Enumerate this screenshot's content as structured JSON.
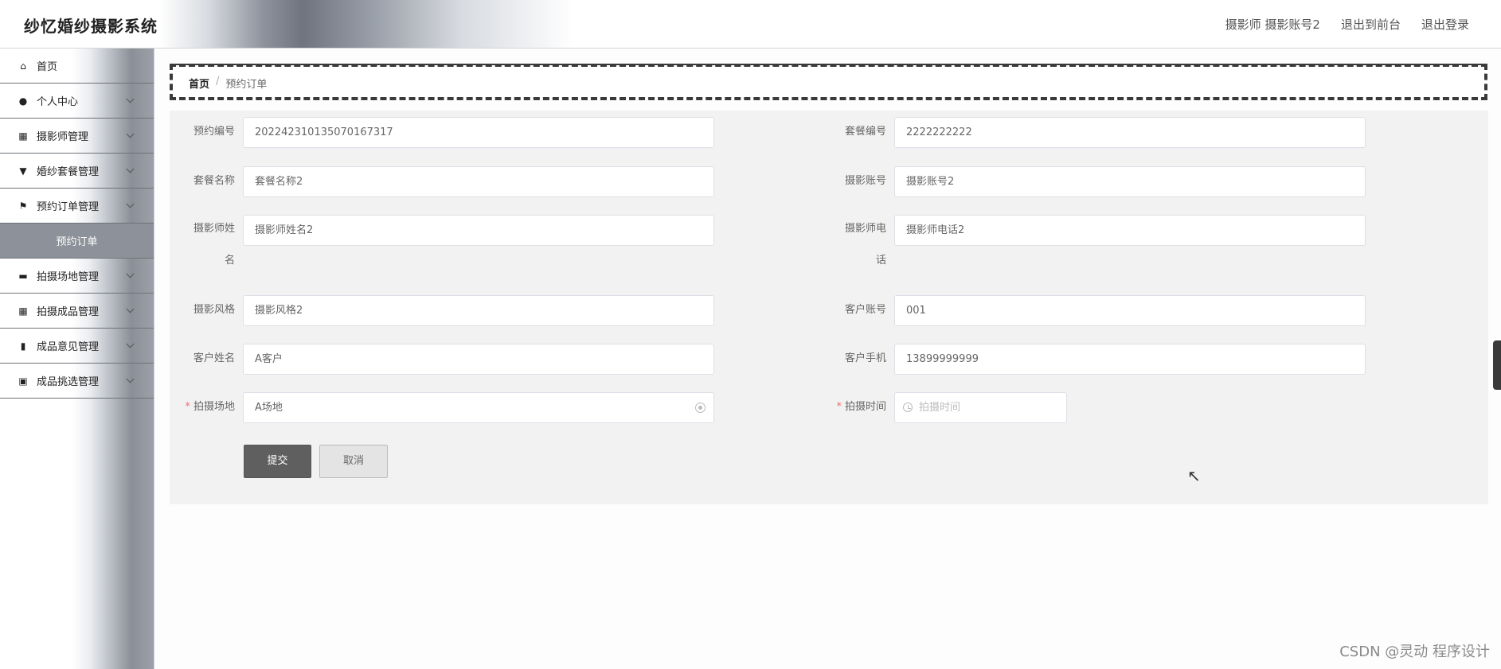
{
  "header": {
    "app_title": "纱忆婚纱摄影系统",
    "user_label": "摄影师 摄影账号2",
    "to_frontend": "退出到前台",
    "logout": "退出登录"
  },
  "sidebar": {
    "items": [
      {
        "label": "首页",
        "icon": "home-icon"
      },
      {
        "label": "个人中心",
        "icon": "user-icon"
      },
      {
        "label": "摄影师管理",
        "icon": "grid-icon"
      },
      {
        "label": "婚纱套餐管理",
        "icon": "dress-icon"
      },
      {
        "label": "预约订单管理",
        "icon": "flag-icon"
      },
      {
        "label": "预约订单",
        "icon": ""
      },
      {
        "label": "拍摄场地管理",
        "icon": "chat-icon"
      },
      {
        "label": "拍摄成品管理",
        "icon": "grid-icon"
      },
      {
        "label": "成品意见管理",
        "icon": "bar-chart-icon"
      },
      {
        "label": "成品挑选管理",
        "icon": "clipboard-icon"
      }
    ]
  },
  "breadcrumb": {
    "home": "首页",
    "separator": "/",
    "current": "预约订单"
  },
  "form": {
    "order_no_label": "预约编号",
    "order_no": "202242310135070167317",
    "package_no_label": "套餐编号",
    "package_no": "2222222222",
    "package_name_label": "套餐名称",
    "package_name": "套餐名称2",
    "photo_account_label": "摄影账号",
    "photo_account": "摄影账号2",
    "photographer_name_label_1": "摄影师姓",
    "photographer_name_label_2": "名",
    "photographer_name": "摄影师姓名2",
    "photographer_phone_label_1": "摄影师电",
    "photographer_phone_label_2": "话",
    "photographer_phone": "摄影师电话2",
    "style_label": "摄影风格",
    "style": "摄影风格2",
    "customer_account_label": "客户账号",
    "customer_account": "001",
    "customer_name_label": "客户姓名",
    "customer_name": "A客户",
    "customer_phone_label": "客户手机",
    "customer_phone": "13899999999",
    "venue_label": "拍摄场地",
    "venue": "A场地",
    "shoot_time_label": "拍摄时间",
    "shoot_time_placeholder": "拍摄时间",
    "required_mark": "*",
    "submit": "提交",
    "cancel": "取消"
  },
  "watermark": "CSDN @灵动 程序设计"
}
